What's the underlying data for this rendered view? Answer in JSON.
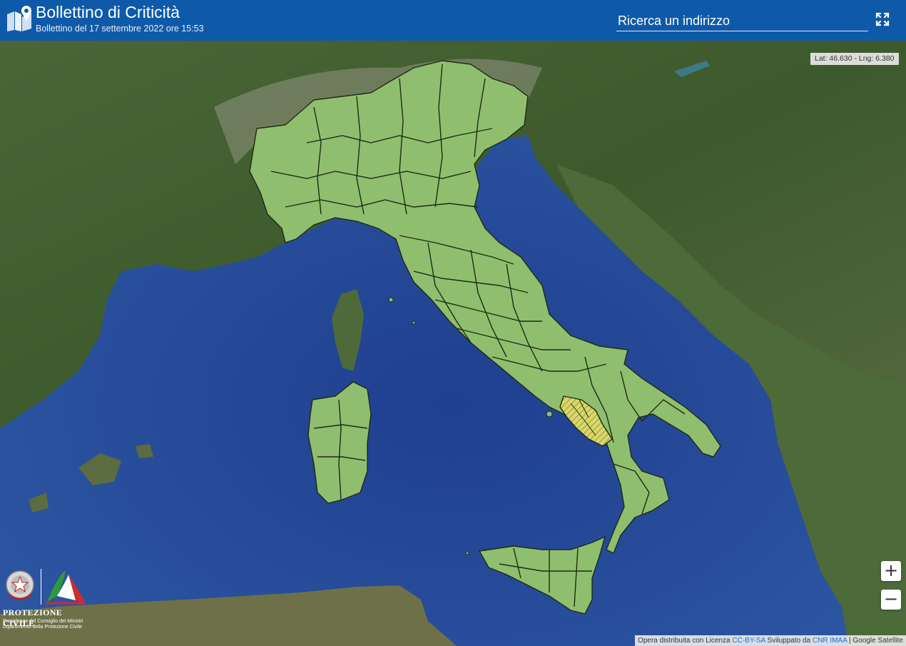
{
  "header": {
    "title": "Bollettino di Criticità",
    "subtitle": "Bollettino del 17 settembre 2022 ore 15:53",
    "search_placeholder": "Ricerca un indirizzo",
    "logo_icon": "map-pin-icon",
    "fullscreen_icon": "fullscreen-icon"
  },
  "map": {
    "coord_readout": "Lat: 46.630 - Lng: 6.380",
    "zoom_in_label": "+",
    "zoom_out_label": "−",
    "base_layer": "Google Satellite",
    "colors": {
      "no_alert": "#8fbf6e",
      "yellow_alert": "#d9d86a",
      "sea": "#2b4f9a",
      "land": "#4f6b3a"
    },
    "alert_zone_hatched": true
  },
  "attribution": {
    "prefix": "Opera distribuita con Licenza",
    "license": "CC-BY-SA",
    "developed": "Sviluppato da",
    "developer": "CNR IMAA",
    "separator": "|",
    "base": "Google Satellite"
  },
  "agency": {
    "name": "PROTEZIONE CIVILE",
    "line1": "Presidenza del Consiglio dei Ministri",
    "line2": "Dipartimento della Protezione Civile"
  }
}
